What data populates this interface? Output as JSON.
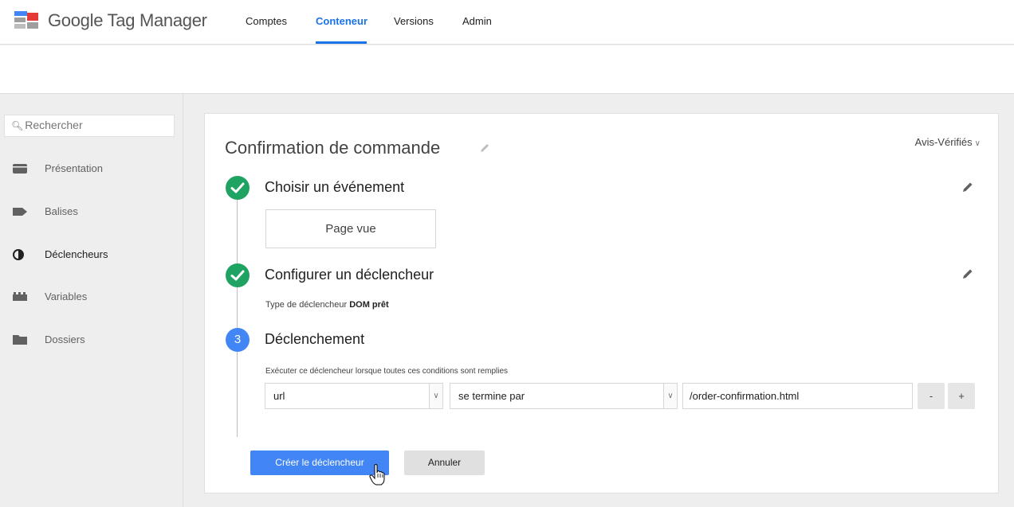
{
  "header": {
    "brand": "Google Tag Manager",
    "tabs": [
      {
        "label": "Comptes",
        "active": false
      },
      {
        "label": "Conteneur",
        "active": true
      },
      {
        "label": "Versions",
        "active": false
      },
      {
        "label": "Admin",
        "active": false
      }
    ]
  },
  "sidebar": {
    "search_placeholder": "Rechercher",
    "items": [
      {
        "label": "Présentation",
        "icon": "overview-icon",
        "active": false
      },
      {
        "label": "Balises",
        "icon": "tag-icon",
        "active": false
      },
      {
        "label": "Déclencheurs",
        "icon": "trigger-icon",
        "active": true
      },
      {
        "label": "Variables",
        "icon": "variables-icon",
        "active": false
      },
      {
        "label": "Dossiers",
        "icon": "folder-icon",
        "active": false
      }
    ]
  },
  "main": {
    "title": "Confirmation de commande",
    "account": "Avis-Vérifiés",
    "steps": [
      {
        "title": "Choisir un événement",
        "status": "done",
        "value": "Page vue"
      },
      {
        "title": "Configurer un déclencheur",
        "status": "done",
        "type_prefix": "Type de déclencheur",
        "type_value": "DOM prêt"
      },
      {
        "number": "3",
        "title": "Déclenchement",
        "status": "active",
        "condition_label": "Exécuter ce déclencheur lorsque toutes ces conditions sont remplies"
      }
    ],
    "condition": {
      "variable": "url",
      "operator": "se termine par",
      "value": "/order-confirmation.html",
      "remove_label": "-",
      "add_label": "+"
    },
    "buttons": {
      "create": "Créer le déclencheur",
      "cancel": "Annuler"
    }
  },
  "colors": {
    "accent": "#1a73e8",
    "success": "#1ea362",
    "step_active": "#4285f4",
    "primary_button": "#4285f4"
  }
}
